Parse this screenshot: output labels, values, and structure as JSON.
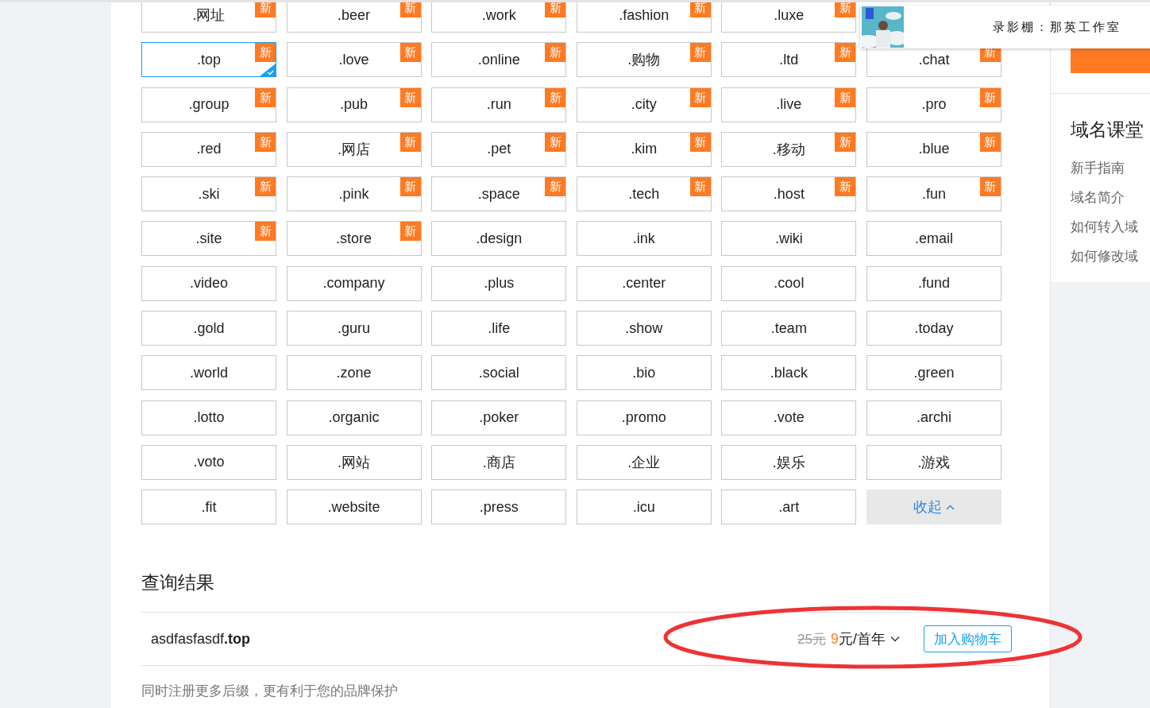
{
  "suffix_grid": {
    "rows": [
      [
        {
          "kind": "suffix",
          "label": ".网址",
          "badge": "新",
          "selected": false
        },
        {
          "kind": "suffix",
          "label": ".beer",
          "badge": "新",
          "selected": false
        },
        {
          "kind": "suffix",
          "label": ".work",
          "badge": "新",
          "selected": false
        },
        {
          "kind": "suffix",
          "label": ".fashion",
          "badge": "新",
          "selected": false
        },
        {
          "kind": "suffix",
          "label": ".luxe",
          "badge": "新",
          "selected": false
        }
      ],
      [
        {
          "kind": "suffix",
          "label": ".top",
          "badge": "新",
          "selected": true
        },
        {
          "kind": "suffix",
          "label": ".love",
          "badge": "新",
          "selected": false
        },
        {
          "kind": "suffix",
          "label": ".online",
          "badge": "新",
          "selected": false
        },
        {
          "kind": "suffix",
          "label": ".购物",
          "badge": "新",
          "selected": false
        },
        {
          "kind": "suffix",
          "label": ".ltd",
          "badge": "新",
          "selected": false
        },
        {
          "kind": "suffix",
          "label": ".chat",
          "badge": "新",
          "selected": false
        }
      ],
      [
        {
          "kind": "suffix",
          "label": ".group",
          "badge": "新",
          "selected": false
        },
        {
          "kind": "suffix",
          "label": ".pub",
          "badge": "新",
          "selected": false
        },
        {
          "kind": "suffix",
          "label": ".run",
          "badge": "新",
          "selected": false
        },
        {
          "kind": "suffix",
          "label": ".city",
          "badge": "新",
          "selected": false
        },
        {
          "kind": "suffix",
          "label": ".live",
          "badge": "新",
          "selected": false
        },
        {
          "kind": "suffix",
          "label": ".pro",
          "badge": "新",
          "selected": false
        }
      ],
      [
        {
          "kind": "suffix",
          "label": ".red",
          "badge": "新",
          "selected": false
        },
        {
          "kind": "suffix",
          "label": ".网店",
          "badge": "新",
          "selected": false
        },
        {
          "kind": "suffix",
          "label": ".pet",
          "badge": "新",
          "selected": false
        },
        {
          "kind": "suffix",
          "label": ".kim",
          "badge": "新",
          "selected": false
        },
        {
          "kind": "suffix",
          "label": ".移动",
          "badge": "新",
          "selected": false
        },
        {
          "kind": "suffix",
          "label": ".blue",
          "badge": "新",
          "selected": false
        }
      ],
      [
        {
          "kind": "suffix",
          "label": ".ski",
          "badge": "新",
          "selected": false
        },
        {
          "kind": "suffix",
          "label": ".pink",
          "badge": "新",
          "selected": false
        },
        {
          "kind": "suffix",
          "label": ".space",
          "badge": "新",
          "selected": false
        },
        {
          "kind": "suffix",
          "label": ".tech",
          "badge": "新",
          "selected": false
        },
        {
          "kind": "suffix",
          "label": ".host",
          "badge": "新",
          "selected": false
        },
        {
          "kind": "suffix",
          "label": ".fun",
          "badge": "新",
          "selected": false
        }
      ],
      [
        {
          "kind": "suffix",
          "label": ".site",
          "badge": "新",
          "selected": false
        },
        {
          "kind": "suffix",
          "label": ".store",
          "badge": "新",
          "selected": false
        },
        {
          "kind": "suffix",
          "label": ".design",
          "selected": false
        },
        {
          "kind": "suffix",
          "label": ".ink",
          "selected": false
        },
        {
          "kind": "suffix",
          "label": ".wiki",
          "selected": false
        },
        {
          "kind": "suffix",
          "label": ".email",
          "selected": false
        }
      ],
      [
        {
          "kind": "suffix",
          "label": ".video",
          "selected": false
        },
        {
          "kind": "suffix",
          "label": ".company",
          "selected": false
        },
        {
          "kind": "suffix",
          "label": ".plus",
          "selected": false
        },
        {
          "kind": "suffix",
          "label": ".center",
          "selected": false
        },
        {
          "kind": "suffix",
          "label": ".cool",
          "selected": false
        },
        {
          "kind": "suffix",
          "label": ".fund",
          "selected": false
        }
      ],
      [
        {
          "kind": "suffix",
          "label": ".gold",
          "selected": false
        },
        {
          "kind": "suffix",
          "label": ".guru",
          "selected": false
        },
        {
          "kind": "suffix",
          "label": ".life",
          "selected": false
        },
        {
          "kind": "suffix",
          "label": ".show",
          "selected": false
        },
        {
          "kind": "suffix",
          "label": ".team",
          "selected": false
        },
        {
          "kind": "suffix",
          "label": ".today",
          "selected": false
        }
      ],
      [
        {
          "kind": "suffix",
          "label": ".world",
          "selected": false
        },
        {
          "kind": "suffix",
          "label": ".zone",
          "selected": false
        },
        {
          "kind": "suffix",
          "label": ".social",
          "selected": false
        },
        {
          "kind": "suffix",
          "label": ".bio",
          "selected": false
        },
        {
          "kind": "suffix",
          "label": ".black",
          "selected": false
        },
        {
          "kind": "suffix",
          "label": ".green",
          "selected": false
        }
      ],
      [
        {
          "kind": "suffix",
          "label": ".lotto",
          "selected": false
        },
        {
          "kind": "suffix",
          "label": ".organic",
          "selected": false
        },
        {
          "kind": "suffix",
          "label": ".poker",
          "selected": false
        },
        {
          "kind": "suffix",
          "label": ".promo",
          "selected": false
        },
        {
          "kind": "suffix",
          "label": ".vote",
          "selected": false
        },
        {
          "kind": "suffix",
          "label": ".archi",
          "selected": false
        }
      ],
      [
        {
          "kind": "suffix",
          "label": ".voto",
          "selected": false
        },
        {
          "kind": "suffix",
          "label": ".网站",
          "selected": false
        },
        {
          "kind": "suffix",
          "label": ".商店",
          "selected": false
        },
        {
          "kind": "suffix",
          "label": ".企业",
          "selected": false
        },
        {
          "kind": "suffix",
          "label": ".娱乐",
          "selected": false
        },
        {
          "kind": "suffix",
          "label": ".游戏",
          "selected": false
        }
      ],
      [
        {
          "kind": "suffix",
          "label": ".fit",
          "selected": false
        },
        {
          "kind": "suffix",
          "label": ".website",
          "selected": false
        },
        {
          "kind": "suffix",
          "label": ".press",
          "selected": false
        },
        {
          "kind": "suffix",
          "label": ".icu",
          "selected": false
        },
        {
          "kind": "suffix",
          "label": ".art",
          "selected": false
        },
        {
          "kind": "toggle",
          "label": "收起"
        }
      ]
    ]
  },
  "results": {
    "title": "查询结果",
    "items": [
      {
        "domain": "asdfasfasdf**.top**",
        "old_price": "25元",
        "price": "9",
        "price_unit": "元/首年",
        "button": "加入购物车"
      }
    ],
    "note": "同时注册更多后缀，更有利于您的品牌保护"
  },
  "sidebar": {
    "section_title": "域名课堂",
    "links": [
      "新手指南",
      "域名简介",
      "如何转入域",
      "如何修改域"
    ]
  },
  "recorder_popup": {
    "title": "录影棚：那英工作室"
  },
  "annotation": {
    "kind": "ellipse"
  }
}
